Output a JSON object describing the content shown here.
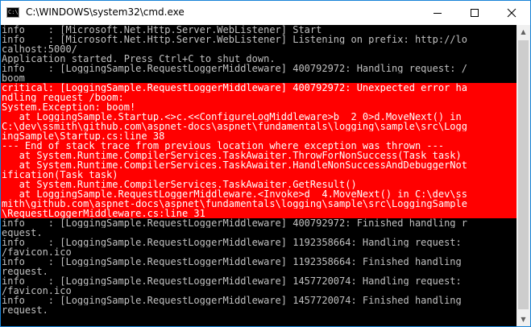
{
  "window": {
    "title": "C:\\WINDOWS\\system32\\cmd.exe",
    "icon_label": "C:\\"
  },
  "icons": {
    "app": "cmd-icon",
    "minimize": "minimize-icon",
    "maximize": "maximize-icon",
    "close": "close-icon",
    "scroll_up": "scroll-up-icon",
    "scroll_down": "scroll-down-icon"
  },
  "colors": {
    "console_background": "#000000",
    "console_text": "#c0c0c0",
    "error_background": "#ff0000",
    "error_text": "#ffffff"
  },
  "console": {
    "lines": [
      {
        "text": "info    : [Microsoft.Net.Http.Server.WebListener] Start",
        "error": false
      },
      {
        "text": "info    : [Microsoft.Net.Http.Server.WebListener] Listening on prefix: http://lo",
        "error": false
      },
      {
        "text": "calhost:5000/",
        "error": false
      },
      {
        "text": "Application started. Press Ctrl+C to shut down.",
        "error": false
      },
      {
        "text": "info    : [LoggingSample.RequestLoggerMiddleware] 400792972: Handling request: /",
        "error": false
      },
      {
        "text": "boom",
        "error": false
      },
      {
        "text": "critical: [LoggingSample.RequestLoggerMiddleware] 400792972: Unexpected error ha",
        "error": true
      },
      {
        "text": "ndling request /boom:",
        "error": true
      },
      {
        "text": "System.Exception: boom!",
        "error": true
      },
      {
        "text": "   at LoggingSample.Startup.<>c.<<ConfigureLogMiddleware>b__2_0>d.MoveNext() in",
        "error": true
      },
      {
        "text": "C:\\dev\\ssmith\\github.com\\aspnet-docs\\aspnet\\fundamentals\\logging\\sample\\src\\Logg",
        "error": true
      },
      {
        "text": "ingSample\\Startup.cs:line 38",
        "error": true
      },
      {
        "text": "--- End of stack trace from previous location where exception was thrown ---",
        "error": true
      },
      {
        "text": "   at System.Runtime.CompilerServices.TaskAwaiter.ThrowForNonSuccess(Task task)",
        "error": true
      },
      {
        "text": "   at System.Runtime.CompilerServices.TaskAwaiter.HandleNonSuccessAndDebuggerNot",
        "error": true
      },
      {
        "text": "ification(Task task)",
        "error": true
      },
      {
        "text": "   at System.Runtime.CompilerServices.TaskAwaiter.GetResult()",
        "error": true
      },
      {
        "text": "   at LoggingSample.RequestLoggerMiddleware.<Invoke>d__4.MoveNext() in C:\\dev\\ss",
        "error": true
      },
      {
        "text": "mith\\github.com\\aspnet-docs\\aspnet\\fundamentals\\logging\\sample\\src\\LoggingSample",
        "error": true
      },
      {
        "text": "\\RequestLoggerMiddleware.cs:line 31",
        "error": true
      },
      {
        "text": "info    : [LoggingSample.RequestLoggerMiddleware] 400792972: Finished handling r",
        "error": false
      },
      {
        "text": "equest.",
        "error": false
      },
      {
        "text": "info    : [LoggingSample.RequestLoggerMiddleware] 1192358664: Handling request:",
        "error": false
      },
      {
        "text": "/favicon.ico",
        "error": false
      },
      {
        "text": "info    : [LoggingSample.RequestLoggerMiddleware] 1192358664: Finished handling",
        "error": false
      },
      {
        "text": "request.",
        "error": false
      },
      {
        "text": "info    : [LoggingSample.RequestLoggerMiddleware] 1457720074: Handling request:",
        "error": false
      },
      {
        "text": "/favicon.ico",
        "error": false
      },
      {
        "text": "info    : [LoggingSample.RequestLoggerMiddleware] 1457720074: Finished handling",
        "error": false
      },
      {
        "text": "request.",
        "error": false
      }
    ]
  }
}
